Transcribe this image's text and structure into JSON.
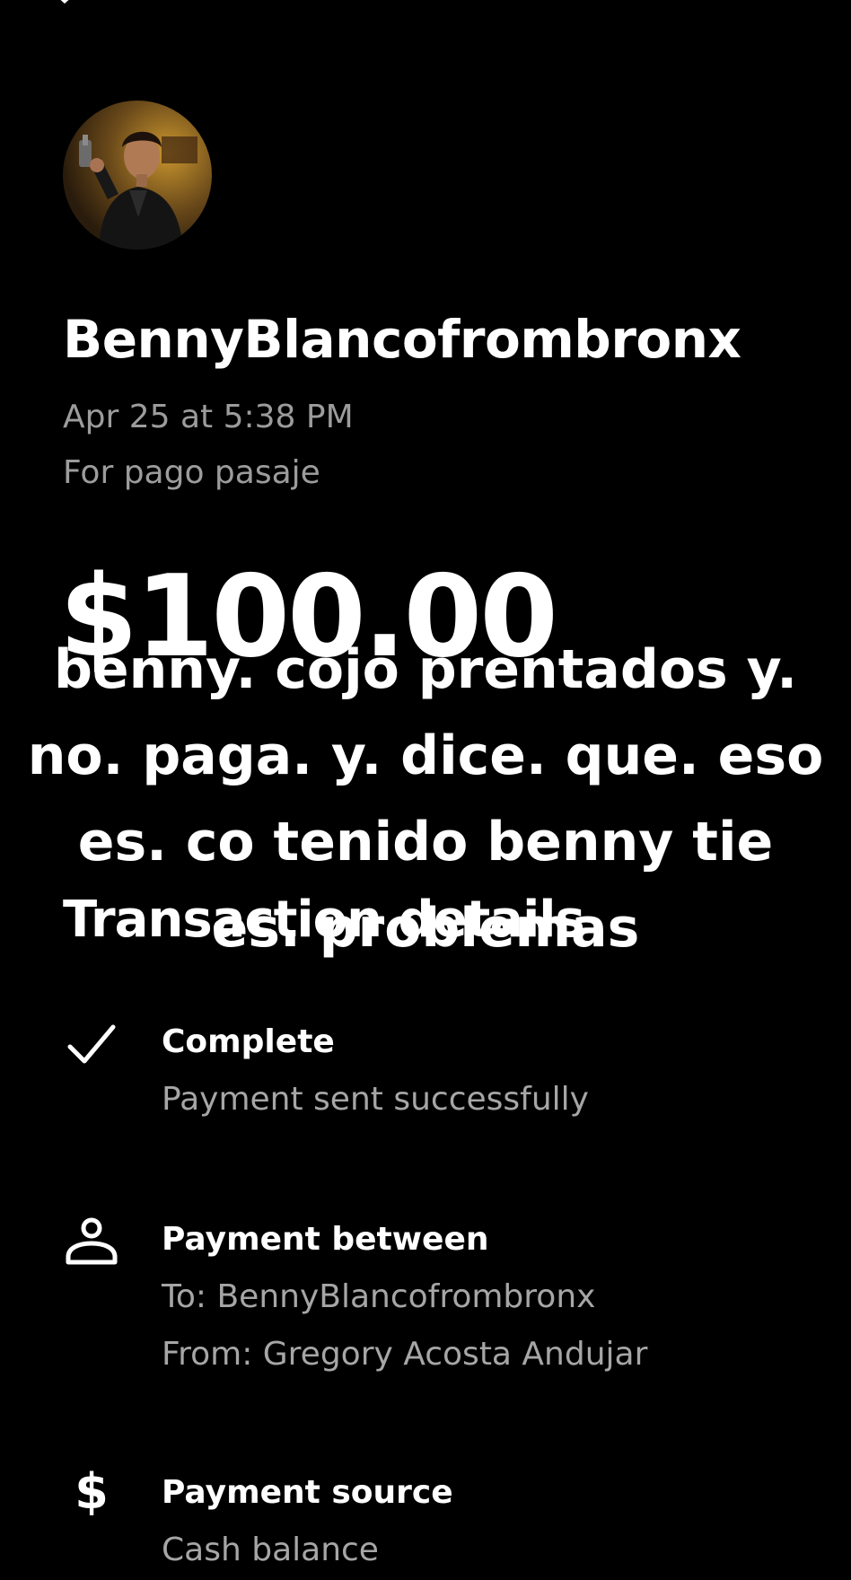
{
  "header": {
    "close_icon": "close-icon"
  },
  "profile": {
    "username": "BennyBlancofrombronx",
    "date": "Apr 25 at 5:38 PM",
    "note": "For pago pasaje"
  },
  "payment": {
    "amount": "$100.00"
  },
  "overlay_caption": {
    "lines": [
      "benny. cojo prentados y.",
      "no. paga. y. dice. que. eso",
      "es. co tenido  benny tie",
      "es. problemas"
    ]
  },
  "transaction_details": {
    "title": "Transaction details",
    "items": [
      {
        "icon": "checkmark-icon",
        "title": "Complete",
        "lines": [
          "Payment sent successfully"
        ]
      },
      {
        "icon": "person-icon",
        "title": "Payment between",
        "lines": [
          "To: BennyBlancofrombronx",
          "From: Gregory Acosta Andujar"
        ]
      },
      {
        "icon": "dollar-icon",
        "glyph": "$",
        "title": "Payment source",
        "lines": [
          "Cash balance"
        ]
      }
    ]
  }
}
